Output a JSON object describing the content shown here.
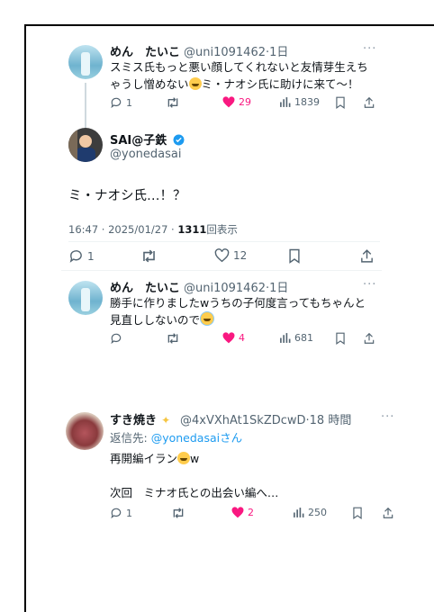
{
  "tweet1": {
    "display_name": "めん　たいこ",
    "handle": "@uni1091462",
    "time": "·1日",
    "more": "···",
    "text_a": "スミス氏もっと悪い顔してくれないと友情芽生えち",
    "text_b": "ゃうし憎めない",
    "text_c": "ミ・ナオシ氏に助けに来て〜！",
    "replies": "1",
    "retweets": "",
    "likes": "29",
    "views": "1839"
  },
  "main": {
    "display_name": "SAI@子鉄",
    "handle": "@yonedasai",
    "text": "ミ・ナオシ氏…！？",
    "meta_time": "16:47 · 2025/01/27 · ",
    "views_count": "1311",
    "views_label": "回表示",
    "replies": "1",
    "likes": "12"
  },
  "tweet2": {
    "display_name": "めん　たいこ",
    "handle": "@uni1091462",
    "time": "·1日",
    "more": "···",
    "text_a": "勝手に作りましたwうちの子何度言ってもちゃんと",
    "text_b": "見直ししないので",
    "likes": "4",
    "views": "681"
  },
  "tweet3": {
    "display_name": "すき焼き",
    "handle": "@4xVXhAt1SkZDcwD",
    "time": "·18 時間",
    "more": "···",
    "reply_to_label": "返信先: ",
    "reply_to_handle": "@yonedasai",
    "reply_to_suffix": "さん",
    "text_a": "再開編イラン",
    "text_a2": "w",
    "text_b": "次回　ミナオ氏との出会い編へ…",
    "replies": "1",
    "likes": "2",
    "views": "250"
  },
  "colors": {
    "like": "#f91880",
    "link": "#1d9bf0",
    "muted": "#536471",
    "verified": "#1d9bf0"
  }
}
